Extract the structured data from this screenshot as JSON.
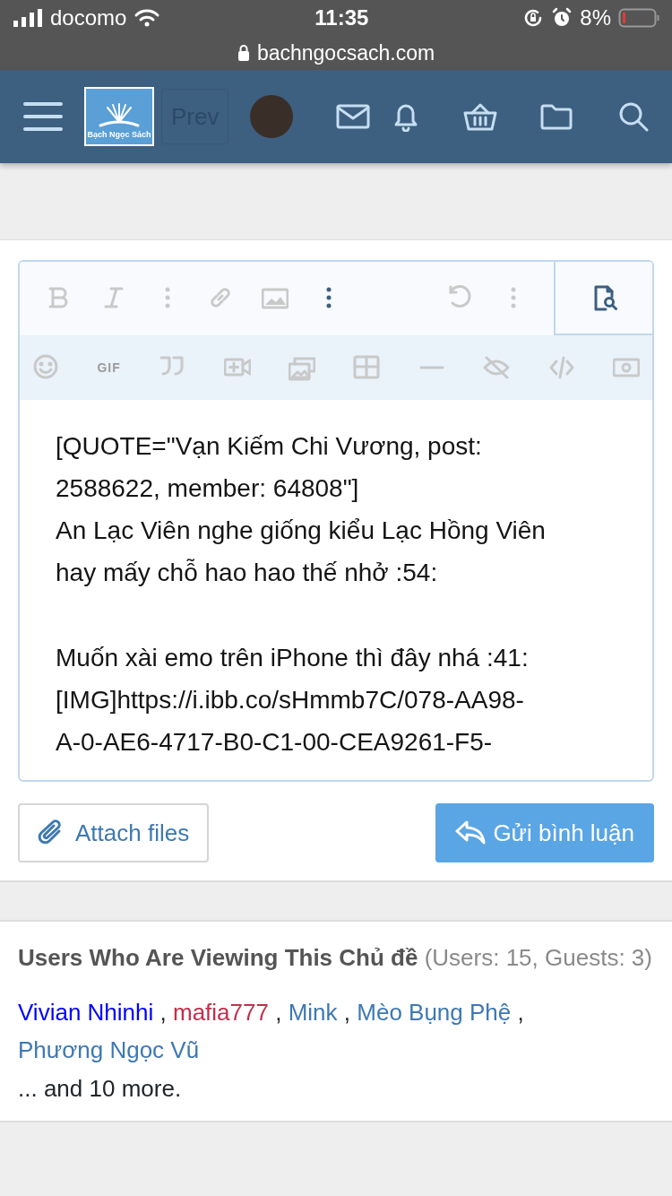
{
  "status_bar": {
    "carrier": "docomo",
    "time": "11:35",
    "battery": "8%"
  },
  "address_bar": {
    "url": "bachngocsach.com"
  },
  "nav": {
    "logo_text": "Bạch Ngọc Sách",
    "pager_prev": "Prev"
  },
  "editor": {
    "toolbar_main": [
      {
        "kind": "bold",
        "active": false
      },
      {
        "kind": "italic",
        "active": false
      },
      {
        "kind": "more",
        "active": false
      },
      {
        "kind": "link",
        "active": false
      },
      {
        "kind": "image",
        "active": false
      },
      {
        "kind": "more",
        "active": true
      },
      {
        "kind": "spacer"
      },
      {
        "kind": "undo",
        "active": false
      },
      {
        "kind": "more",
        "active": false
      }
    ],
    "preview": {
      "active": true
    },
    "toolbar_extra": [
      {
        "kind": "smilie",
        "active": false
      },
      {
        "kind": "gif",
        "text": "GIF",
        "active": false
      },
      {
        "kind": "quote",
        "active": false
      },
      {
        "kind": "video",
        "active": false
      },
      {
        "kind": "media",
        "active": false
      },
      {
        "kind": "table",
        "active": false
      },
      {
        "kind": "hr",
        "active": false
      },
      {
        "kind": "spoiler",
        "active": false
      },
      {
        "kind": "code",
        "active": false
      },
      {
        "kind": "money",
        "active": false
      }
    ],
    "blocks": [
      [
        "[QUOTE=\"Vạn Kiếm Chi Vương, post:",
        "2588622, member: 64808\"]",
        "An Lạc Viên nghe giống kiểu Lạc Hồng Viên",
        "hay mấy chỗ hao hao thế nhở  :54:"
      ],
      [
        "Muốn xài emo trên iPhone thì đây nhá :41:",
        "[IMG]https://i.ibb.co/sHmmb7C/078-AA98-",
        "A-0-AE6-4717-B0-C1-00-CEA9261-F5-"
      ]
    ]
  },
  "buttons": [
    {
      "kind": "attach",
      "label": "Attach files"
    },
    {
      "kind": "submit",
      "label": "Gửi bình luận"
    }
  ],
  "viewers": {
    "title": "Users Who Are Viewing This Chủ đề",
    "counts": "(Users: 15, Guests: 3)",
    "users": [
      {
        "name": "Vivian Nhinhi",
        "color": "#0000ff",
        "separator": ","
      },
      {
        "name": "mafia777",
        "color": "#c0304a",
        "separator": ","
      },
      {
        "name": "Mink",
        "color": "#3e78b2",
        "separator": ","
      },
      {
        "name": "Mèo Bụng Phệ",
        "color": "#3e78b2",
        "separator": ","
      },
      {
        "name": "Phương Ngọc Vũ",
        "color": "#3e78b2"
      }
    ],
    "more": "... and 10 more."
  }
}
